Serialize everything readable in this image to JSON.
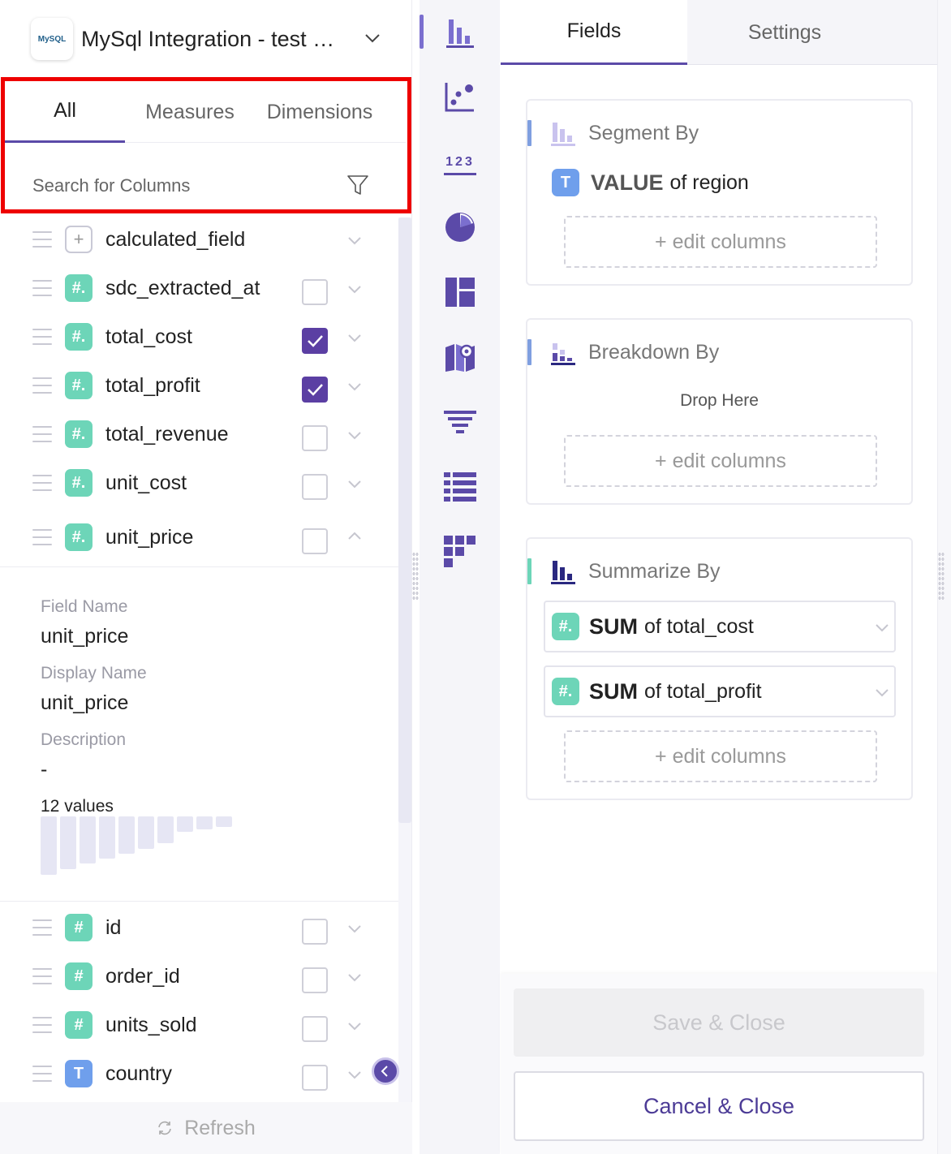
{
  "source": {
    "title": "MySql Integration - test schema",
    "logo_text": "MySQL"
  },
  "left_tabs": [
    {
      "label": "All",
      "active": true
    },
    {
      "label": "Measures",
      "active": false
    },
    {
      "label": "Dimensions",
      "active": false
    }
  ],
  "search": {
    "placeholder": "Search for Columns"
  },
  "fields": [
    {
      "name": "calculated_field",
      "type": "calc",
      "has_checkbox": false,
      "checked": false
    },
    {
      "name": "sdc_extracted_at",
      "type": "num",
      "has_checkbox": true,
      "checked": false
    },
    {
      "name": "total_cost",
      "type": "num",
      "has_checkbox": true,
      "checked": true
    },
    {
      "name": "total_profit",
      "type": "num",
      "has_checkbox": true,
      "checked": true
    },
    {
      "name": "total_revenue",
      "type": "num",
      "has_checkbox": true,
      "checked": false
    },
    {
      "name": "unit_cost",
      "type": "num",
      "has_checkbox": true,
      "checked": false
    },
    {
      "name": "unit_price",
      "type": "num",
      "has_checkbox": true,
      "checked": false,
      "expanded": true
    }
  ],
  "field_detail": {
    "field_name_label": "Field Name",
    "field_name_value": "unit_price",
    "display_name_label": "Display Name",
    "display_name_value": "unit_price",
    "description_label": "Description",
    "description_value": "-",
    "values_count": "12 values",
    "histogram": [
      1.0,
      0.9,
      0.8,
      0.72,
      0.64,
      0.56,
      0.46,
      0.26,
      0.22,
      0.18
    ]
  },
  "fields_lower": [
    {
      "name": "id",
      "type": "num"
    },
    {
      "name": "order_id",
      "type": "num"
    },
    {
      "name": "units_sold",
      "type": "num"
    },
    {
      "name": "country",
      "type": "text"
    }
  ],
  "badges": {
    "num": "#.",
    "id_num": "#",
    "text": "T",
    "calc": "+"
  },
  "refresh": {
    "label": "Refresh"
  },
  "viz_icons": [
    "bar-chart-icon",
    "scatter-chart-icon",
    "numbers-icon",
    "pie-chart-icon",
    "treemap-icon",
    "map-icon",
    "funnel-icon",
    "table-icon",
    "heatmap-icon"
  ],
  "numbers_icon_text": "123",
  "right_tabs": [
    {
      "label": "Fields",
      "active": true
    },
    {
      "label": "Settings",
      "active": false
    }
  ],
  "segment_by": {
    "title": "Segment By",
    "value_agg": "VALUE",
    "value_rest": "of region",
    "edit_label": "+ edit columns"
  },
  "breakdown_by": {
    "title": "Breakdown By",
    "drop_here": "Drop Here",
    "edit_label": "+ edit columns"
  },
  "summarize_by": {
    "title": "Summarize By",
    "items": [
      {
        "agg": "SUM",
        "rest": "of total_cost"
      },
      {
        "agg": "SUM",
        "rest": "of total_profit"
      }
    ],
    "edit_label": "+ edit columns"
  },
  "actions": {
    "save_label": "Save & Close",
    "cancel_label": "Cancel & Close"
  },
  "colors": {
    "accent": "#5b4aa8",
    "numeric_badge": "#6dd5b8",
    "text_badge": "#6f9fec",
    "highlight": "#ee0000"
  }
}
